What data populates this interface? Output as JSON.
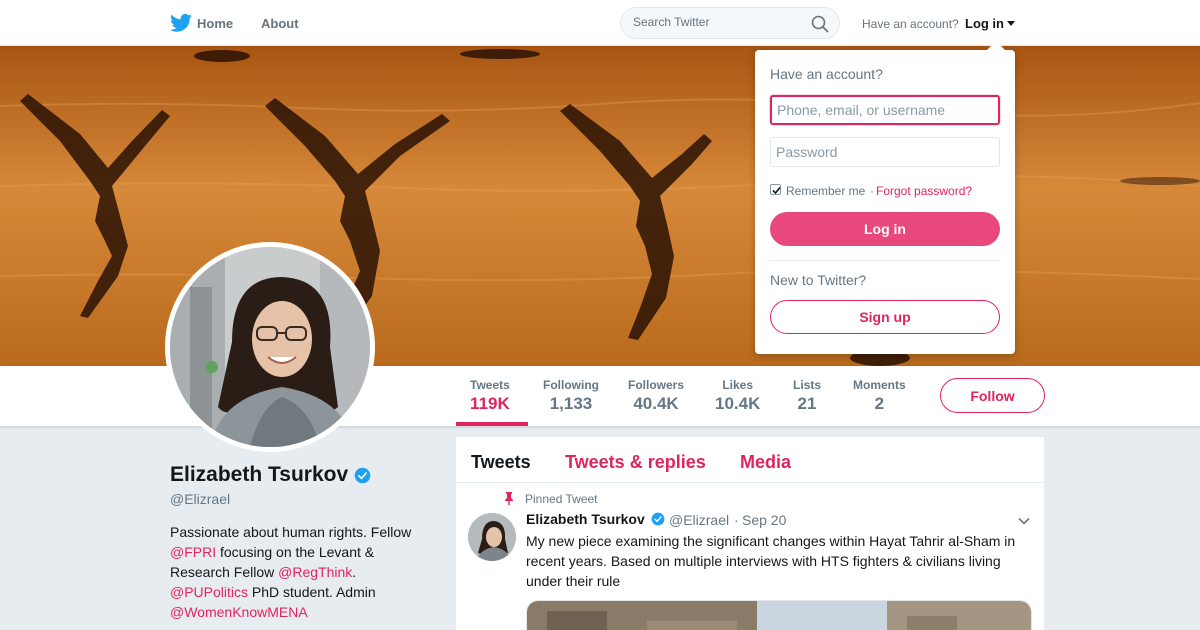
{
  "nav": {
    "home_label": "Home",
    "about_label": "About",
    "search_placeholder": "Search Twitter",
    "have_account": "Have an account?",
    "login_label": "Log in"
  },
  "profile": {
    "name": "Elizabeth Tsurkov",
    "handle": "@Elizrael",
    "verified": true,
    "bio_parts": {
      "p1": "Passionate about human rights. Fellow ",
      "m1": "@FPRI",
      "p2": " focusing on the Levant & Research Fellow ",
      "m2": "@RegThink",
      "p3": ". ",
      "m3": "@PUPolitics",
      "p4": " PhD student. Admin ",
      "m4": "@WomenKnowMENA"
    }
  },
  "stats": [
    {
      "label": "Tweets",
      "value": "119K"
    },
    {
      "label": "Following",
      "value": "1,133"
    },
    {
      "label": "Followers",
      "value": "40.4K"
    },
    {
      "label": "Likes",
      "value": "10.4K"
    },
    {
      "label": "Lists",
      "value": "21"
    },
    {
      "label": "Moments",
      "value": "2"
    }
  ],
  "follow_label": "Follow",
  "timeline": {
    "tabs": [
      "Tweets",
      "Tweets & replies",
      "Media"
    ],
    "pinned_label": "Pinned Tweet",
    "tweet": {
      "name": "Elizabeth Tsurkov",
      "handle": "@Elizrael",
      "separator": "·",
      "time": "Sep 20",
      "text": "My new piece examining the significant changes within Hayat Tahrir al-Sham in recent years. Based on multiple interviews with HTS fighters & civilians living under their rule"
    }
  },
  "login_dropdown": {
    "title": "Have an account?",
    "username_placeholder": "Phone, email, or username",
    "password_placeholder": "Password",
    "remember_label": "Remember me",
    "remember_checked": true,
    "separator": "·",
    "forgot_label": "Forgot password?",
    "login_button": "Log in",
    "new_label": "New to Twitter?",
    "signup_button": "Sign up"
  },
  "colors": {
    "accent": "#e0245e",
    "twitter_blue": "#1da1f2",
    "login_button_bg": "#e8487c"
  },
  "icons": {
    "logo": "twitter-bird-icon",
    "search": "search-icon",
    "verified": "verified-badge-icon",
    "pin": "pin-icon",
    "chevron": "chevron-down-icon"
  }
}
